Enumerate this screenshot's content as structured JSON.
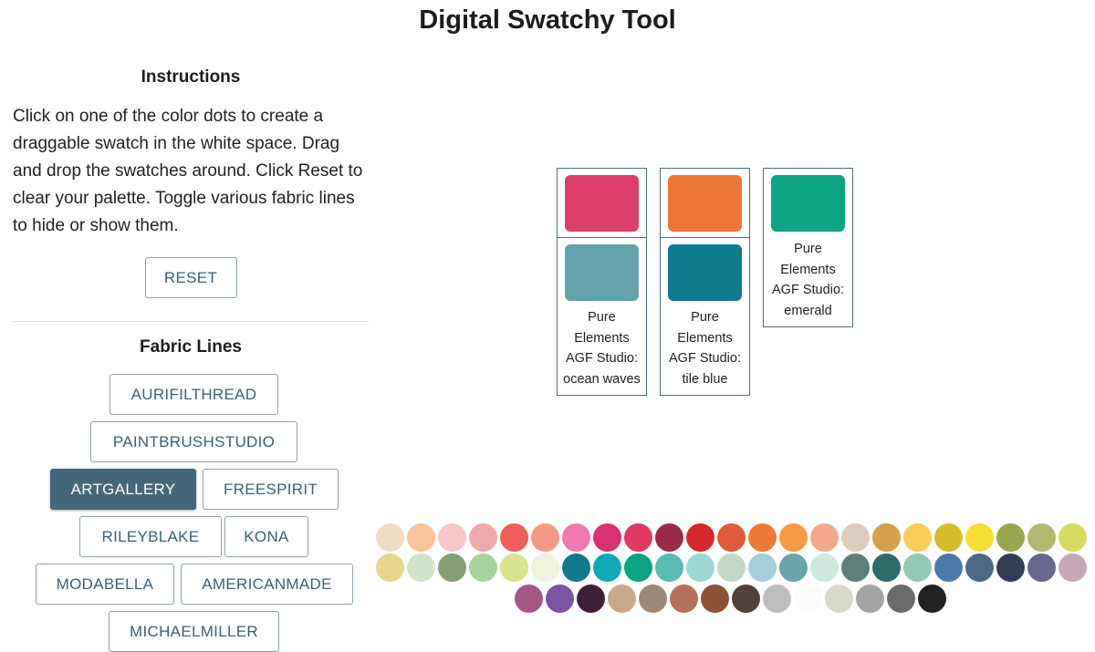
{
  "page": {
    "title": "Digital Swatchy Tool"
  },
  "instructions": {
    "heading": "Instructions",
    "text": "Click on one of the color dots to create a draggable swatch in the white space. Drag and drop the swatches around. Click Reset to clear your palette. Toggle various fabric lines to hide or show them.",
    "reset_label": "RESET"
  },
  "fabric": {
    "heading": "Fabric Lines",
    "lines": [
      {
        "label": "AURIFILTHREAD",
        "active": false
      },
      {
        "label": "PAINTBRUSHSTUDIO",
        "active": false
      },
      {
        "label": "ARTGALLERY",
        "active": true
      },
      {
        "label": "FREESPIRIT",
        "active": false
      },
      {
        "label": "RILEYBLAKE",
        "active": false
      },
      {
        "label": "KONA",
        "active": false
      },
      {
        "label": "MODABELLA",
        "active": false
      },
      {
        "label": "AMERICANMADE",
        "active": false
      },
      {
        "label": "MICHAELMILLER",
        "active": false
      }
    ]
  },
  "palette": {
    "columns": [
      {
        "chips": [
          "#dd3e6a",
          "#65a1ab"
        ],
        "label": [
          "Pure",
          "Elements",
          "AGF Studio:",
          "ocean waves"
        ]
      },
      {
        "chips": [
          "#ee7737",
          "#0e7b8f"
        ],
        "label": [
          "Pure",
          "Elements",
          "AGF Studio:",
          "tile blue"
        ]
      },
      {
        "chips": [
          "#0ca483"
        ],
        "label": [
          "Pure",
          "Elements",
          "AGF Studio:",
          "emerald"
        ]
      }
    ]
  },
  "color_dots": {
    "rows": [
      [
        "#efdcc5",
        "#f9c49a",
        "#f6c6c9",
        "#eeaaaa",
        "#ec5f5a",
        "#f39a86",
        "#f07bb1",
        "#d73173",
        "#e0395f",
        "#9a2c4a",
        "#d7282e",
        "#e05a3b",
        "#ee7a35",
        "#f79a45",
        "#f4a98a",
        "#ddcbbd",
        "#d59f4e",
        "#f9cc5a",
        "#d5be2c",
        "#f7de33",
        "#9aa64d",
        "#b4b972",
        "#d6da5e"
      ],
      [
        "#e7d58b",
        "#d1e4cb",
        "#859f77",
        "#aad49e",
        "#d7e48b",
        "#f0f4dd",
        "#137a8d",
        "#11a9b6",
        "#0ca483",
        "#5bbab2",
        "#9dd7d3",
        "#c1d8c8",
        "#a5cddc",
        "#68a4aa",
        "#cfe9df",
        "#5f7f79",
        "#2e6c6a",
        "#95c9b5",
        "#4c7aa8",
        "#4e6985",
        "#353c56",
        "#676890",
        "#c4a8b8"
      ],
      [
        "#a45784",
        "#7c54a0",
        "#3f1e37",
        "#c7aa8c",
        "#9e8877",
        "#b77058",
        "#8c5336",
        "#4f413b",
        "#bdbdbd",
        "#fcfbf9",
        "#d8d9cc",
        "#a4a4a4",
        "#6a6a6a",
        "#222222"
      ]
    ]
  }
}
